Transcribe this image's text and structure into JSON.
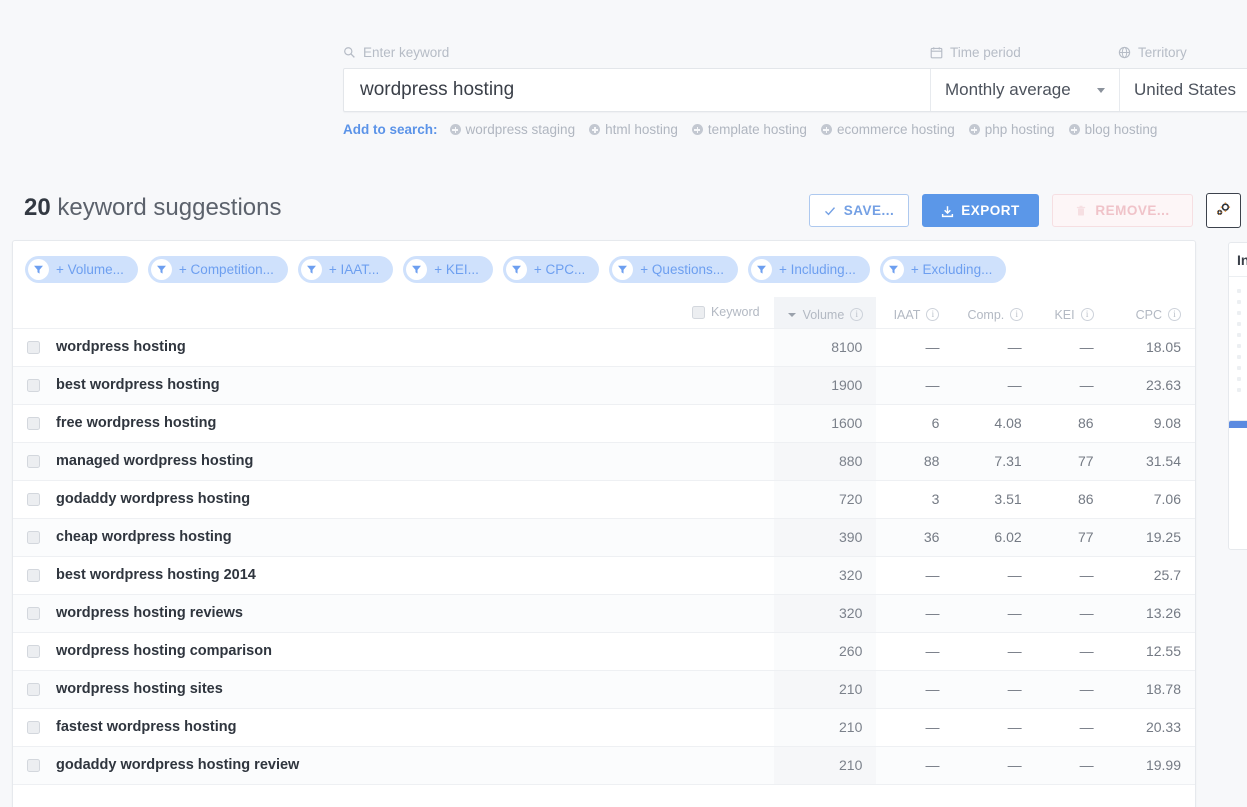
{
  "search": {
    "keyword_label": "Enter keyword",
    "keyword_placeholder": "Enter keyword",
    "keyword_value": "wordpress hosting",
    "time_period_label": "Time period",
    "time_period_value": "Monthly average",
    "territory_label": "Territory",
    "territory_value": "United States",
    "search_icon": "search-icon",
    "calendar_icon": "calendar-icon",
    "globe_icon": "globe-icon"
  },
  "add_to_search": {
    "lead": "Add to search:",
    "suggestions": [
      "wordpress staging",
      "html hosting",
      "template hosting",
      "ecommerce hosting",
      "php hosting",
      "blog hosting"
    ]
  },
  "results_header": {
    "count": "20",
    "label": "keyword suggestions"
  },
  "toolbar": {
    "save_label": "SAVE...",
    "export_label": "EXPORT",
    "remove_label": "REMOVE...",
    "save_icon": "check-icon",
    "export_icon": "download-icon",
    "remove_icon": "trash-icon",
    "settings_icon": "gear-icon"
  },
  "filters": {
    "chips": [
      "+ Volume...",
      "+ Competition...",
      "+ IAAT...",
      "+ KEI...",
      "+ CPC...",
      "+ Questions...",
      "+ Including...",
      "+ Excluding..."
    ],
    "chip_icon": "filter-funnel-icon"
  },
  "table": {
    "columns": [
      {
        "key": "keyword",
        "label": "Keyword",
        "info": false,
        "sorted": false
      },
      {
        "key": "volume",
        "label": "Volume",
        "info": true,
        "sorted": true
      },
      {
        "key": "iaat",
        "label": "IAAT",
        "info": true,
        "sorted": false
      },
      {
        "key": "comp",
        "label": "Comp.",
        "info": true,
        "sorted": false
      },
      {
        "key": "kei",
        "label": "KEI",
        "info": true,
        "sorted": false
      },
      {
        "key": "cpc",
        "label": "CPC",
        "info": true,
        "sorted": false
      }
    ],
    "sort_indicator": "chevron-down-icon",
    "rows": [
      {
        "keyword": "wordpress hosting",
        "volume": "8100",
        "iaat": "—",
        "comp": "—",
        "kei": "—",
        "cpc": "18.05"
      },
      {
        "keyword": "best wordpress hosting",
        "volume": "1900",
        "iaat": "—",
        "comp": "—",
        "kei": "—",
        "cpc": "23.63"
      },
      {
        "keyword": "free wordpress hosting",
        "volume": "1600",
        "iaat": "6",
        "comp": "4.08",
        "kei": "86",
        "cpc": "9.08"
      },
      {
        "keyword": "managed wordpress hosting",
        "volume": "880",
        "iaat": "88",
        "comp": "7.31",
        "kei": "77",
        "cpc": "31.54"
      },
      {
        "keyword": "godaddy wordpress hosting",
        "volume": "720",
        "iaat": "3",
        "comp": "3.51",
        "kei": "86",
        "cpc": "7.06"
      },
      {
        "keyword": "cheap wordpress hosting",
        "volume": "390",
        "iaat": "36",
        "comp": "6.02",
        "kei": "77",
        "cpc": "19.25"
      },
      {
        "keyword": "best wordpress hosting 2014",
        "volume": "320",
        "iaat": "—",
        "comp": "—",
        "kei": "—",
        "cpc": "25.7"
      },
      {
        "keyword": "wordpress hosting reviews",
        "volume": "320",
        "iaat": "—",
        "comp": "—",
        "kei": "—",
        "cpc": "13.26"
      },
      {
        "keyword": "wordpress hosting comparison",
        "volume": "260",
        "iaat": "—",
        "comp": "—",
        "kei": "—",
        "cpc": "12.55"
      },
      {
        "keyword": "wordpress hosting sites",
        "volume": "210",
        "iaat": "—",
        "comp": "—",
        "kei": "—",
        "cpc": "18.78"
      },
      {
        "keyword": "fastest wordpress hosting",
        "volume": "210",
        "iaat": "—",
        "comp": "—",
        "kei": "—",
        "cpc": "20.33"
      },
      {
        "keyword": "godaddy wordpress hosting review",
        "volume": "210",
        "iaat": "—",
        "comp": "—",
        "kei": "—",
        "cpc": "19.99"
      }
    ]
  },
  "side_panel": {
    "title": "In"
  },
  "colors": {
    "accent_blue": "#5b97e8",
    "chip_bg": "#cfe1fc",
    "chip_text": "#6d9ff0",
    "remove_red": "#f0c3c9",
    "page_bg": "#f7f8fa"
  }
}
